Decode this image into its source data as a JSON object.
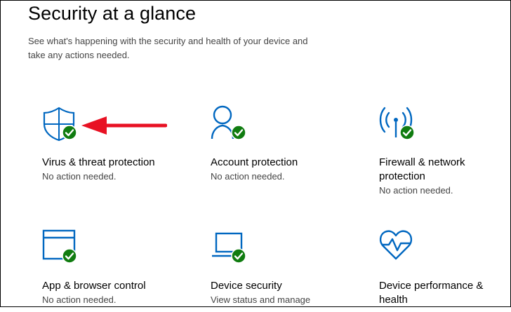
{
  "header": {
    "title": "Security at a glance",
    "subtitle": "See what's happening with the security and health of your device and take any actions needed."
  },
  "tiles": [
    {
      "label": "Virus & threat protection",
      "status": "No action needed.",
      "icon": "shield-icon",
      "state": "ok"
    },
    {
      "label": "Account protection",
      "status": "No action needed.",
      "icon": "person-icon",
      "state": "ok"
    },
    {
      "label": "Firewall & network protection",
      "status": "No action needed.",
      "icon": "antenna-icon",
      "state": "ok"
    },
    {
      "label": "App & browser control",
      "status": "No action needed.",
      "icon": "browser-window-icon",
      "state": "ok"
    },
    {
      "label": "Device security",
      "status": "View status and manage",
      "icon": "laptop-icon",
      "state": "ok"
    },
    {
      "label": "Device performance & health",
      "status": "",
      "icon": "heart-pulse-icon",
      "state": null
    }
  ],
  "colors": {
    "icon_blue": "#0067c0",
    "check_green": "#107c10",
    "annotation_red": "#e81123"
  }
}
